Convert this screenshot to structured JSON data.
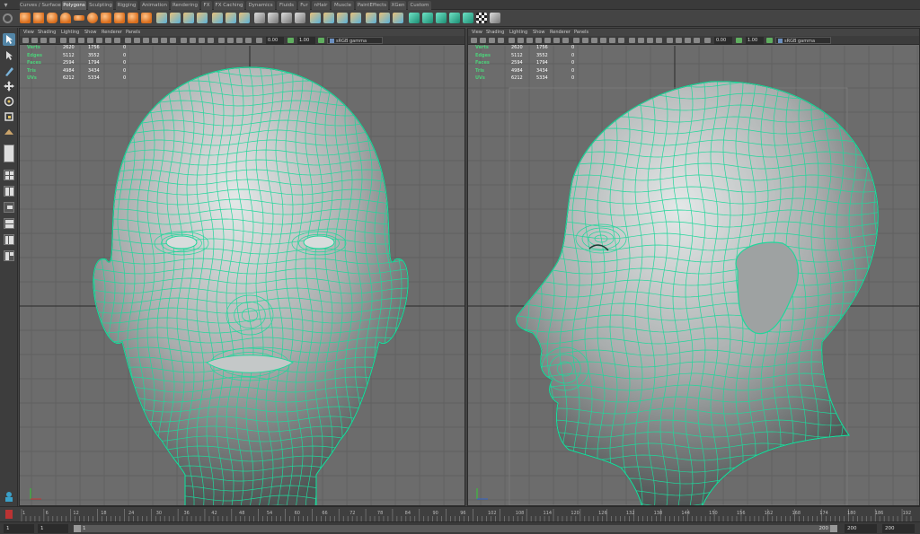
{
  "shelf_tabs": [
    "Curves / Surfaces",
    "Polygons",
    "Sculpting",
    "Rigging",
    "Animation",
    "Rendering",
    "FX",
    "FX Caching",
    "Dynamics",
    "Fluids",
    "Fur",
    "nHair",
    "Muscle",
    "PaintEffects",
    "XGen",
    "Custom"
  ],
  "active_shelf_tab": "Polygons",
  "viewport_menu": [
    "View",
    "Shading",
    "Lighting",
    "Show",
    "Renderer",
    "Panels"
  ],
  "viewport_toolbar": {
    "exposure": "0.00",
    "gamma": "1.00",
    "color_space": "sRGB gamma"
  },
  "hud": {
    "rows": [
      {
        "label": "Verts",
        "a": "2620",
        "b": "1756",
        "c": "0"
      },
      {
        "label": "Edges",
        "a": "5112",
        "b": "3552",
        "c": "0"
      },
      {
        "label": "Faces",
        "a": "2594",
        "b": "1794",
        "c": "0"
      },
      {
        "label": "Tris",
        "a": "4984",
        "b": "3434",
        "c": "0"
      },
      {
        "label": "UVs",
        "a": "6212",
        "b": "5334",
        "c": "0"
      }
    ]
  },
  "timeline": {
    "ticks": [
      "1",
      "6",
      "12",
      "18",
      "24",
      "30",
      "36",
      "42",
      "48",
      "54",
      "60",
      "66",
      "72",
      "78",
      "84",
      "90",
      "96",
      "102",
      "108",
      "114",
      "120",
      "126",
      "132",
      "138",
      "144",
      "150",
      "156",
      "162",
      "168",
      "174",
      "180",
      "186",
      "192"
    ],
    "tick_labels_visible": true
  },
  "range_slider": {
    "start_field": "1",
    "current_field": "1",
    "bar_start": "1",
    "bar_end": "200",
    "end_field": "200",
    "max_field": "200"
  },
  "colors": {
    "wire": "#20d79b",
    "grid_bg": "#6c6c6c",
    "hud_label": "#4dd07a",
    "select_blue": "#5285a6"
  },
  "icons": {
    "select_tool": "arrow-icon",
    "lasso_tool": "lasso-icon",
    "paint_tool": "paint-brush-icon",
    "move_tool": "move-icon",
    "rotate_tool": "rotate-icon",
    "scale_tool": "scale-icon"
  }
}
